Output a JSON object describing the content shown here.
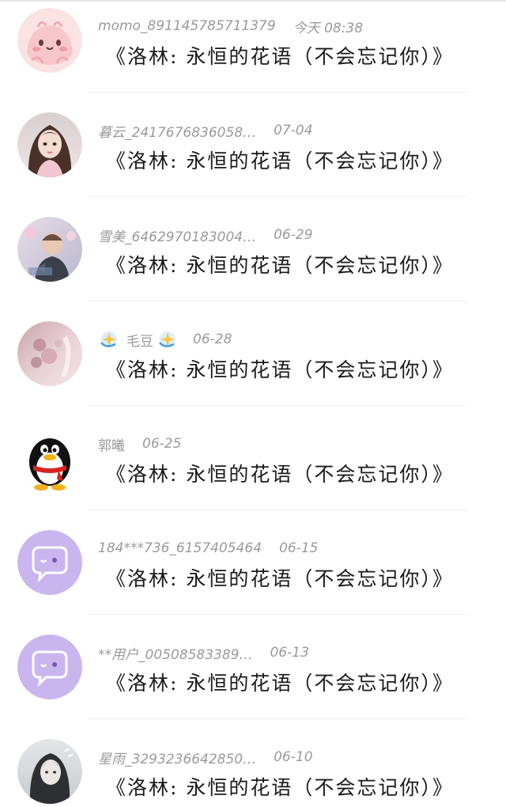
{
  "comments": [
    {
      "username": "momo_891145785711379",
      "time": "今天 08:38",
      "text": "《洛林: 永恒的花语（不会忘记你）》",
      "avatar": "pink-blob-avatar"
    },
    {
      "username": "暮云_2417676836058…",
      "time": "07-04",
      "text": "《洛林: 永恒的花语（不会忘记你）》",
      "avatar": "girl-portrait-avatar"
    },
    {
      "username": "雪美_6462970183004…",
      "time": "06-29",
      "text": "《洛林: 永恒的花语（不会忘记你）》",
      "avatar": "child-photo-avatar"
    },
    {
      "username": "毛豆",
      "time": "06-28",
      "text": "《洛林: 永恒的花语（不会忘记你）》",
      "avatar": "pink-floral-avatar",
      "emoji": "sparkle-emoji"
    },
    {
      "username": "郭曦",
      "time": "06-25",
      "text": "《洛林: 永恒的花语（不会忘记你）》",
      "avatar": "qq-penguin-avatar"
    },
    {
      "username": "184***736_6157405464",
      "time": "06-15",
      "text": "《洛林: 永恒的花语（不会忘记你）》",
      "avatar": "purple-chat-avatar"
    },
    {
      "username": "**用户_00508583389…",
      "time": "06-13",
      "text": "《洛林: 永恒的花语（不会忘记你）》",
      "avatar": "purple-chat-avatar"
    },
    {
      "username": "星雨_3293236642850…",
      "time": "06-10",
      "text": "《洛林: 永恒的花语（不会忘记你）》",
      "avatar": "girl-bw-avatar"
    }
  ]
}
